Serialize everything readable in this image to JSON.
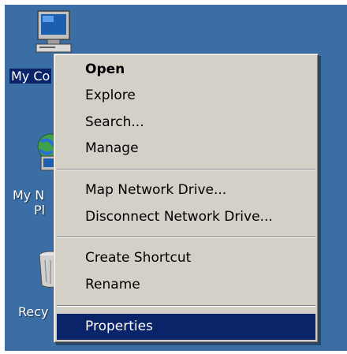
{
  "desktop": {
    "icons": [
      {
        "icon": "my-computer-icon",
        "label": "My Co",
        "selected": true
      },
      {
        "icon": "my-network-places-icon",
        "label_line1": "My N",
        "label_line2": "Pl"
      },
      {
        "icon": "recycle-bin-icon",
        "label": "Recy"
      }
    ]
  },
  "context_menu": {
    "items": [
      {
        "label": "Open",
        "bold": true
      },
      {
        "label": "Explore"
      },
      {
        "label": "Search..."
      },
      {
        "label": "Manage"
      },
      {
        "label": "Map Network Drive..."
      },
      {
        "label": "Disconnect Network Drive..."
      },
      {
        "label": "Create Shortcut"
      },
      {
        "label": "Rename"
      },
      {
        "label": "Properties",
        "highlighted": true
      }
    ]
  },
  "colors": {
    "desktop_bg": "#3a6ea5",
    "menu_bg": "#d4d0c8",
    "highlight": "#0a246a"
  }
}
